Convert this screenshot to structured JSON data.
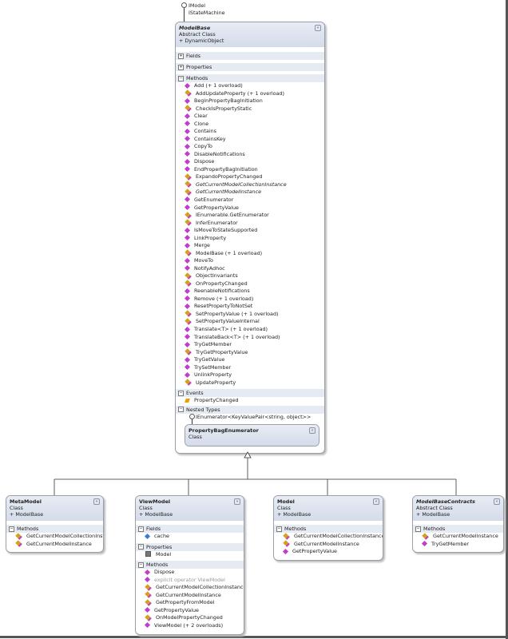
{
  "base": {
    "interfaces": [
      "IModel",
      "IStateMachine"
    ],
    "name": "ModelBase",
    "kind": "Abstract Class",
    "inherits": "+ DynamicObject",
    "sections": {
      "fields": "Fields",
      "properties": "Properties",
      "methods": "Methods",
      "events": "Events",
      "nested": "Nested Types"
    },
    "methods": [
      {
        "n": "Add (+ 1 overload)"
      },
      {
        "n": "AddUpdateProperty (+ 1 overload)",
        "k": "prot"
      },
      {
        "n": "BeginPropertyBagInitiation"
      },
      {
        "n": "CheckIsPropertyStatic",
        "k": "prot"
      },
      {
        "n": "Clear"
      },
      {
        "n": "Clone"
      },
      {
        "n": "Contains"
      },
      {
        "n": "ContainsKey"
      },
      {
        "n": "CopyTo"
      },
      {
        "n": "DisableNotifications"
      },
      {
        "n": "Dispose"
      },
      {
        "n": "EndPropertyBagInitiation"
      },
      {
        "n": "ExpandoPropertyChanged",
        "k": "prot"
      },
      {
        "n": "GetCurrentModelCollectionInstance",
        "k": "prot",
        "s": "i"
      },
      {
        "n": "GetCurrentModelInstance",
        "k": "prot",
        "s": "i"
      },
      {
        "n": "GetEnumerator"
      },
      {
        "n": "GetPropertyValue"
      },
      {
        "n": "IEnumerable.GetEnumerator",
        "k": "prot"
      },
      {
        "n": "InferEnumerator",
        "k": "prot"
      },
      {
        "n": "IsMoveToStateSupported"
      },
      {
        "n": "LinkProperty"
      },
      {
        "n": "Merge"
      },
      {
        "n": "ModelBase (+ 1 overload)",
        "k": "prot"
      },
      {
        "n": "MoveTo"
      },
      {
        "n": "NotifyAdhoc"
      },
      {
        "n": "ObjectInvariants",
        "k": "prot"
      },
      {
        "n": "OnPropertyChanged",
        "k": "prot"
      },
      {
        "n": "ReenableNotifications"
      },
      {
        "n": "Remove (+ 1 overload)"
      },
      {
        "n": "ResetPropertyToNotSet"
      },
      {
        "n": "SetPropertyValue (+ 1 overload)",
        "k": "prot"
      },
      {
        "n": "SetPropertyValueInternal",
        "k": "prot"
      },
      {
        "n": "Translate<T> (+ 1 overload)"
      },
      {
        "n": "TranslateBack<T> (+ 1 overload)"
      },
      {
        "n": "TryGetMember"
      },
      {
        "n": "TryGetPropertyValue",
        "k": "prot"
      },
      {
        "n": "TryGetValue"
      },
      {
        "n": "TrySetMember"
      },
      {
        "n": "UnlinkProperty"
      },
      {
        "n": "UpdateProperty",
        "k": "prot"
      }
    ],
    "events": [
      {
        "n": "PropertyChanged",
        "k": "evt"
      }
    ],
    "nested": {
      "interface": "IEnumerator<KeyValuePair<string, object>>",
      "name": "PropertyBagEnumerator",
      "kind": "Class"
    }
  },
  "derived": [
    {
      "id": "metamodel",
      "name": "MetaModel",
      "kind": "Class",
      "inherits": "+ ModelBase",
      "sections": [
        {
          "title": "Methods",
          "rows": [
            {
              "n": "GetCurrentModelCollectionInsta...",
              "k": "prot"
            },
            {
              "n": "GetCurrentModelInstance",
              "k": "prot"
            }
          ]
        }
      ]
    },
    {
      "id": "viewmodel",
      "name": "ViewModel",
      "kind": "Class",
      "inherits": "+ ModelBase",
      "sections": [
        {
          "title": "Fields",
          "rows": [
            {
              "n": "cache",
              "k": "fld"
            }
          ]
        },
        {
          "title": "Properties",
          "rows": [
            {
              "n": "Model",
              "k": "prop"
            }
          ]
        },
        {
          "title": "Methods",
          "rows": [
            {
              "n": "Dispose"
            },
            {
              "n": "explicit operator ViewModel",
              "s": "g"
            },
            {
              "n": "GetCurrentModelCollectionInstance",
              "k": "prot"
            },
            {
              "n": "GetCurrentModelInstance",
              "k": "prot"
            },
            {
              "n": "GetPropertyFromModel",
              "k": "prot"
            },
            {
              "n": "GetPropertyValue"
            },
            {
              "n": "OnModelPropertyChanged",
              "k": "prot"
            },
            {
              "n": "ViewModel (+ 2 overloads)"
            }
          ]
        }
      ]
    },
    {
      "id": "model",
      "name": "Model",
      "kind": "Class",
      "inherits": "+ ModelBase",
      "sections": [
        {
          "title": "Methods",
          "rows": [
            {
              "n": "GetCurrentModelCollectionInstance",
              "k": "prot"
            },
            {
              "n": "GetCurrentModelInstance",
              "k": "prot"
            },
            {
              "n": "GetPropertyValue"
            }
          ]
        }
      ]
    },
    {
      "id": "contracts",
      "name": "ModelBaseContracts",
      "kind": "Abstract Class",
      "inherits": "+ ModelBase",
      "italic": true,
      "sections": [
        {
          "title": "Methods",
          "rows": [
            {
              "n": "GetCurrentModelInstance",
              "k": "prot"
            },
            {
              "n": "TryGetMember"
            }
          ]
        }
      ]
    }
  ]
}
